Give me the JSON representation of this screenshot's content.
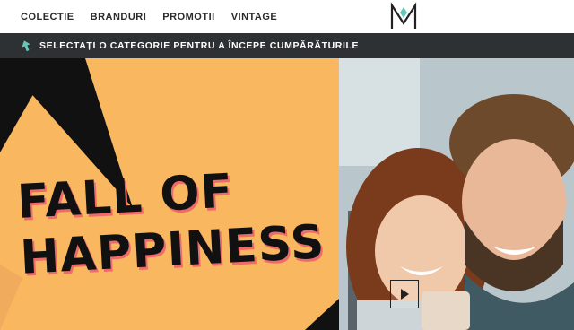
{
  "nav": {
    "items": [
      {
        "label": "COLECTIE"
      },
      {
        "label": "BRANDURI"
      },
      {
        "label": "PROMOTII"
      },
      {
        "label": "VINTAGE"
      }
    ]
  },
  "logo": {
    "text": "M"
  },
  "category_bar": {
    "text": "SELECTAȚI O CATEGORIE PENTRU A ÎNCEPE CUMPĂRĂTURILE",
    "icon": "arrow-up-icon",
    "icon_color": "#66c6b8"
  },
  "hero": {
    "headline_line1": "FALL OF",
    "headline_line2": "HAPPINESS",
    "bg_color": "#f9b760",
    "play_icon": "play-icon"
  }
}
